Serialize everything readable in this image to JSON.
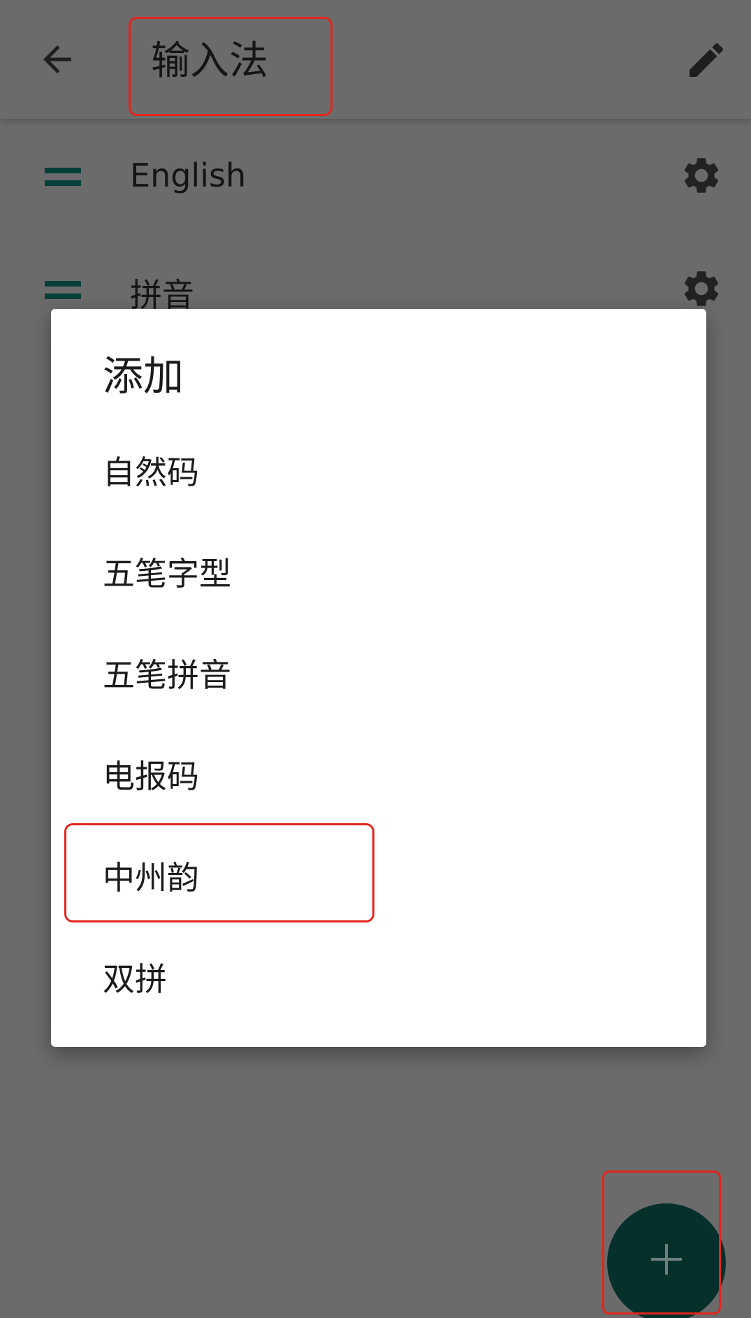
{
  "app_bar": {
    "title": "输入法",
    "back_icon": "arrow-left-icon",
    "edit_icon": "pencil-icon"
  },
  "methods": [
    {
      "label": "English",
      "icon": "gear-icon"
    },
    {
      "label": "拼音",
      "icon": "gear-icon"
    }
  ],
  "dialog": {
    "title": "添加",
    "items": [
      {
        "label": "自然码"
      },
      {
        "label": "五笔字型"
      },
      {
        "label": "五笔拼音"
      },
      {
        "label": "电报码"
      },
      {
        "label": "中州韵"
      },
      {
        "label": "双拼"
      }
    ]
  },
  "fab": {
    "icon": "plus-icon"
  },
  "colors": {
    "scrim": "#6b6b6b",
    "accent": "#073f3a",
    "fab": "#06302c",
    "highlight": "#e3251c",
    "dialog_bg": "#ffffff"
  }
}
